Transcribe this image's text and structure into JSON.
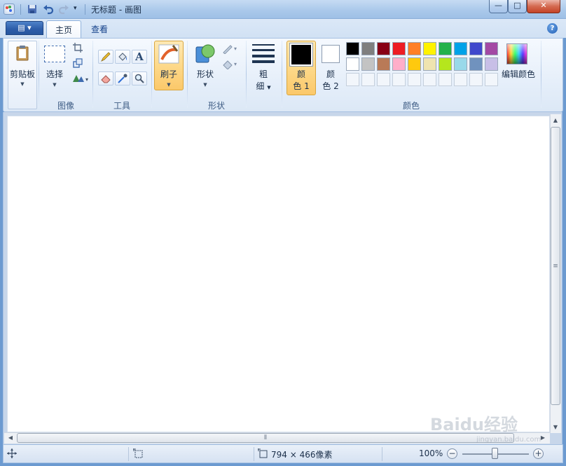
{
  "window": {
    "title": "无标题 - 画图",
    "buttons": {
      "minimize": "—",
      "maximize": "□",
      "close": "✕"
    }
  },
  "quick_access": {
    "items": [
      "paint-app-icon",
      "save-icon",
      "undo-icon",
      "redo-icon",
      "customize-dropdown-icon"
    ]
  },
  "ribbon": {
    "app_menu_label": "▤ ▾",
    "tabs": [
      {
        "label": "主页",
        "active": true
      },
      {
        "label": "查看",
        "active": false
      }
    ],
    "help": "?",
    "groups": {
      "clipboard": {
        "label": "剪贴板"
      },
      "image": {
        "label": "图像",
        "select_label": "选择"
      },
      "tools": {
        "label": "工具",
        "text_tool": "A"
      },
      "brushes": {
        "label": "刷子"
      },
      "shapes": {
        "label": "形状",
        "shapes_label": "形状"
      },
      "size": {
        "line1": "粗",
        "line2": "细"
      },
      "colors": {
        "label": "颜色",
        "color1_line1": "颜",
        "color1_line2": "色 1",
        "color2_line1": "颜",
        "color2_line2": "色 2",
        "edit_colors": "编辑颜色",
        "color1_value": "#000000",
        "color2_value": "#ffffff",
        "palette_row1": [
          "#000000",
          "#7f7f7f",
          "#880015",
          "#ed1c24",
          "#ff7f27",
          "#fff200",
          "#22b14c",
          "#00a2e8",
          "#3f48cc",
          "#a349a4"
        ],
        "palette_row2": [
          "#ffffff",
          "#c3c3c3",
          "#b97a57",
          "#ffaec9",
          "#ffc90e",
          "#efe4b0",
          "#b5e61d",
          "#99d9ea",
          "#7092be",
          "#c8bfe7"
        ]
      }
    }
  },
  "scrollbar": {
    "grip": "≡",
    "grip_h": "⦀"
  },
  "statusbar": {
    "dimensions": "794 × 466像素",
    "zoom": "100%",
    "zoom_out": "−",
    "zoom_in": "+"
  },
  "watermark": {
    "main": "Baidu经验",
    "sub": "jingyan.baidu.com"
  }
}
